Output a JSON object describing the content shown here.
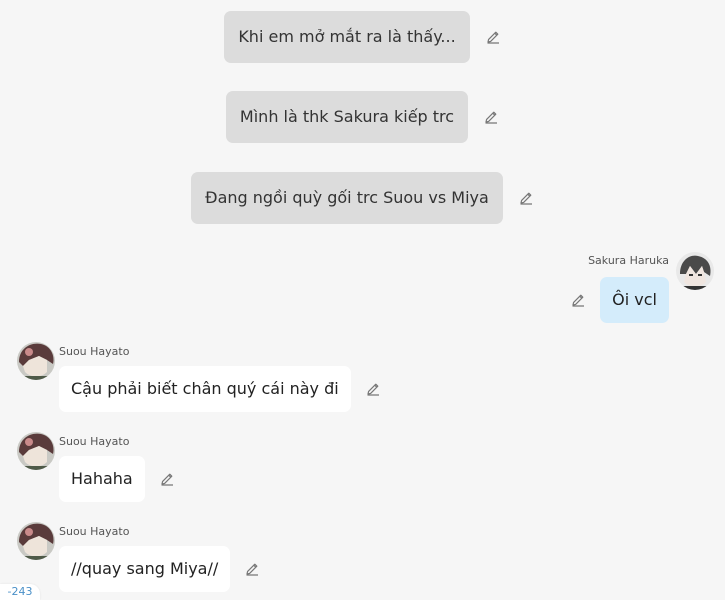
{
  "narrations": [
    {
      "text": "Khi em mở mắt ra là thấy..."
    },
    {
      "text": "Mình là thk Sakura kiếp trc"
    },
    {
      "text": "Đang ngồi quỳ gối trc Suou vs Miya"
    }
  ],
  "messages": [
    {
      "sender": "Sakura Haruka",
      "text": "Ôi vcl"
    },
    {
      "sender": "Suou Hayato",
      "text": "Cậu phải biết chân quý cái này đi"
    },
    {
      "sender": "Suou Hayato",
      "text": "Hahaha"
    },
    {
      "sender": "Suou Hayato",
      "text": "//quay sang Miya//"
    }
  ],
  "counter": "-243",
  "colors": {
    "background": "#f6f6f6",
    "narration_bubble": "#dcdcdc",
    "own_bubble": "#d4ecfb",
    "other_bubble": "#ffffff",
    "counter_text": "#4a90c8"
  },
  "icons": {
    "edit": "pencil-edit-icon"
  }
}
